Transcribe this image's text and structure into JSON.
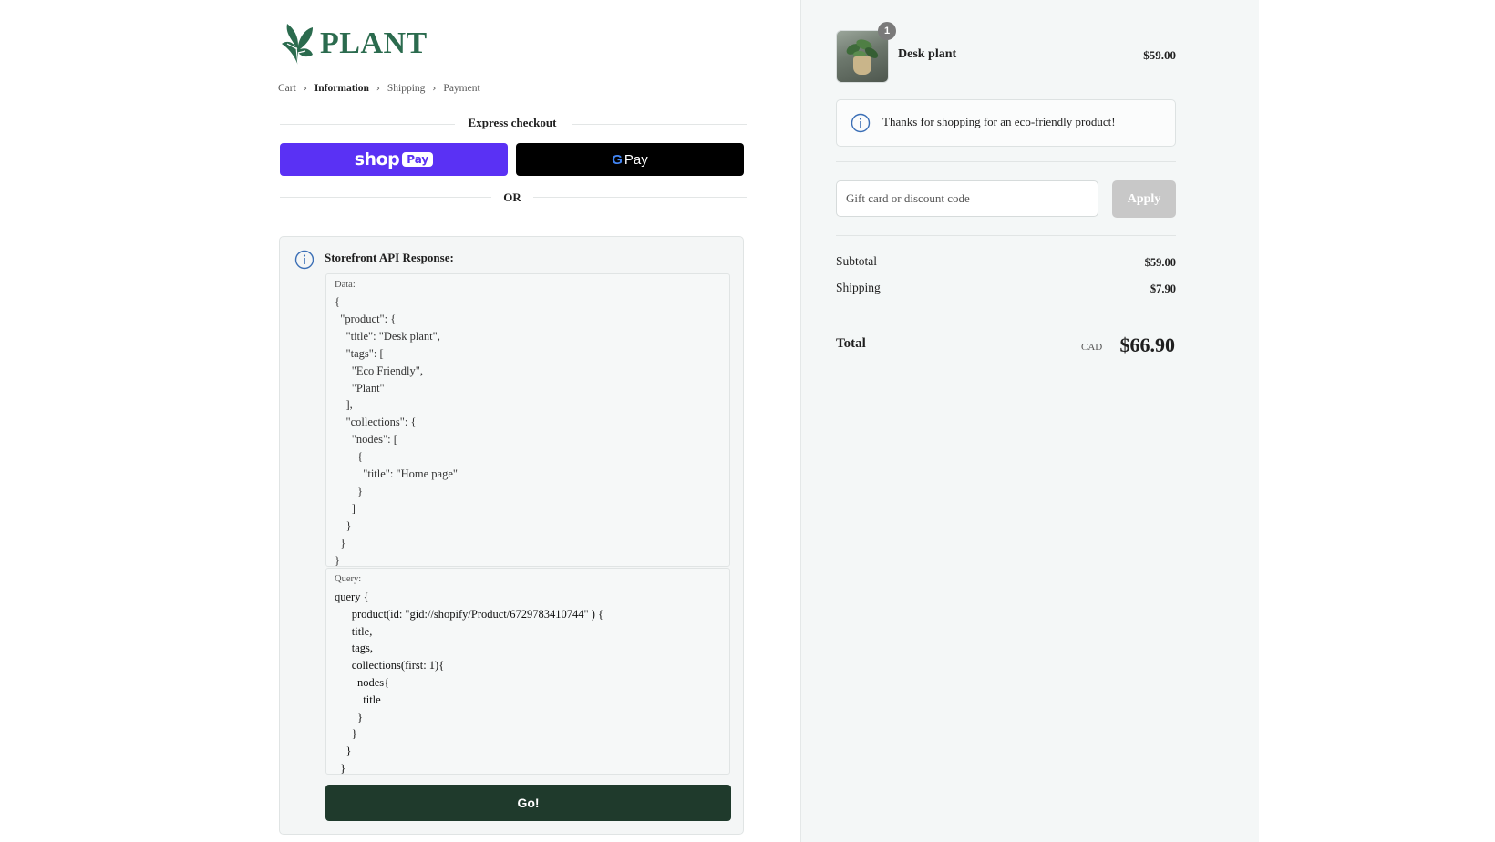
{
  "brand": {
    "name": "PLANT",
    "color": "#2b6b4e"
  },
  "breadcrumb": [
    "Cart",
    "Information",
    "Shipping",
    "Payment"
  ],
  "breadcrumb_current": "Information",
  "express": {
    "title": "Express checkout",
    "shop_pay": {
      "word": "shop",
      "pill": "Pay",
      "color": "#5a31f4"
    },
    "google_pay": {
      "g": "G",
      "text": "Pay"
    },
    "or_label": "OR"
  },
  "api": {
    "title": "Storefront API Response:",
    "data_label": "Data:",
    "data_code": "{\n  \"product\": {\n    \"title\": \"Desk plant\",\n    \"tags\": [\n      \"Eco Friendly\",\n      \"Plant\"\n    ],\n    \"collections\": {\n      \"nodes\": [\n        {\n          \"title\": \"Home page\"\n        }\n      ]\n    }\n  }\n}",
    "query_label": "Query:",
    "query_code": "query {\n      product(id: \"gid://shopify/Product/6729783410744\" ) {\n      title,\n      tags,\n      collections(first: 1){\n        nodes{\n          title\n        }\n      }\n    }\n  }",
    "go_label": "Go!",
    "go_color": "#1f3a2c"
  },
  "summary": {
    "product": {
      "name": "Desk plant",
      "price": "$59.00",
      "quantity": "1"
    },
    "eco_message": "Thanks for shopping for an eco-friendly product!",
    "discount": {
      "placeholder": "Gift card or discount code",
      "apply_label": "Apply"
    },
    "subtotal_label": "Subtotal",
    "subtotal_value": "$59.00",
    "shipping_label": "Shipping",
    "shipping_value": "$7.90",
    "total_label": "Total",
    "total_currency": "CAD",
    "total_value": "$66.90"
  }
}
